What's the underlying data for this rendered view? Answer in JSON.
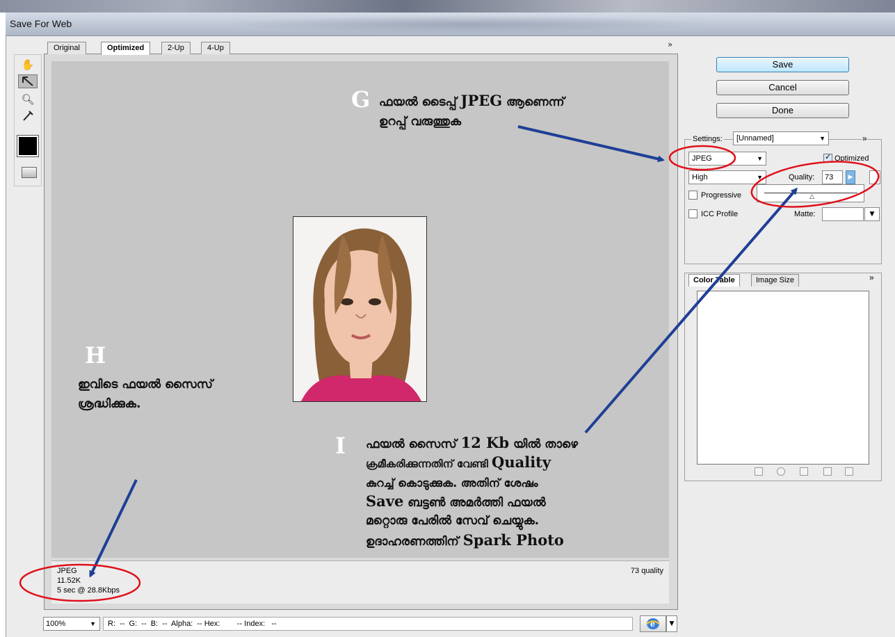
{
  "window": {
    "title": "Save For Web"
  },
  "tabs": [
    {
      "label": "Original"
    },
    {
      "label": "Optimized",
      "active": true
    },
    {
      "label": "2-Up"
    },
    {
      "label": "4-Up"
    }
  ],
  "tabs_more": "»",
  "tools": [
    "hand-icon",
    "slice-select-icon",
    "zoom-icon",
    "eyedropper-icon",
    "color-swatch",
    "toggle-slices-icon"
  ],
  "buttons": {
    "save": "Save",
    "cancel": "Cancel",
    "done": "Done"
  },
  "settings": {
    "label": "Settings:",
    "preset": "[Unnamed]",
    "more": "»",
    "format": "JPEG",
    "optimized_label": "Optimized",
    "optimized_checked": true,
    "quality_preset": "High",
    "quality_label": "Quality:",
    "quality_value": "73",
    "progressive_label": "Progressive",
    "icc_label": "ICC Profile",
    "matte_label": "Matte:"
  },
  "panel_tabs": [
    {
      "label": "Color Table",
      "active": true
    },
    {
      "label": "Image Size"
    }
  ],
  "panel_more": "»",
  "info": {
    "format": "JPEG",
    "size": "11.52K",
    "download": "5 sec @ 28.8Kbps",
    "quality": "73 quality"
  },
  "status": {
    "zoom": "100%",
    "readout": "R:  --  G:  --  B:  --  Alpha:  -- Hex:        -- Index:   --"
  },
  "annotations": {
    "g": {
      "letter": "G",
      "line1_a": "ഫയൽ ടൈപ്പ് ",
      "line1_b": "JPEG",
      "line1_c": " ആണെന്ന്",
      "line2": "ഉറപ്പ് വരുത്തുക"
    },
    "h": {
      "letter": "H",
      "line1": "ഇവിടെ ഫയൽ സൈസ്",
      "line2": "ശ്രദ്ധിക്കുക."
    },
    "i": {
      "letter": "I",
      "l1a": "ഫയൽ സൈസ് ",
      "l1b": "12 Kb",
      "l1c": " യിൽ താഴെ",
      "l2a": "ക്രമീകരിക്കുന്നതിന് വേണ്ടി ",
      "l2b": "Quality",
      "l3": "കുറച്ച് കൊടുക്കുക. അതിന് ശേഷം",
      "l4a": "Save",
      "l4b": " ബട്ടൺ അമർത്തി ഫയൽ",
      "l5": "മറ്റൊരു പേരിൽ സേവ് ചെയ്യുക.",
      "l6a": "ഉദാഹരണത്തിന് ",
      "l6b": "Spark Photo"
    }
  },
  "colors": {
    "annotation_arrow": "#1f3f96",
    "annotation_circle": "#e0101a",
    "preview_bg": "#c6c6c6"
  }
}
